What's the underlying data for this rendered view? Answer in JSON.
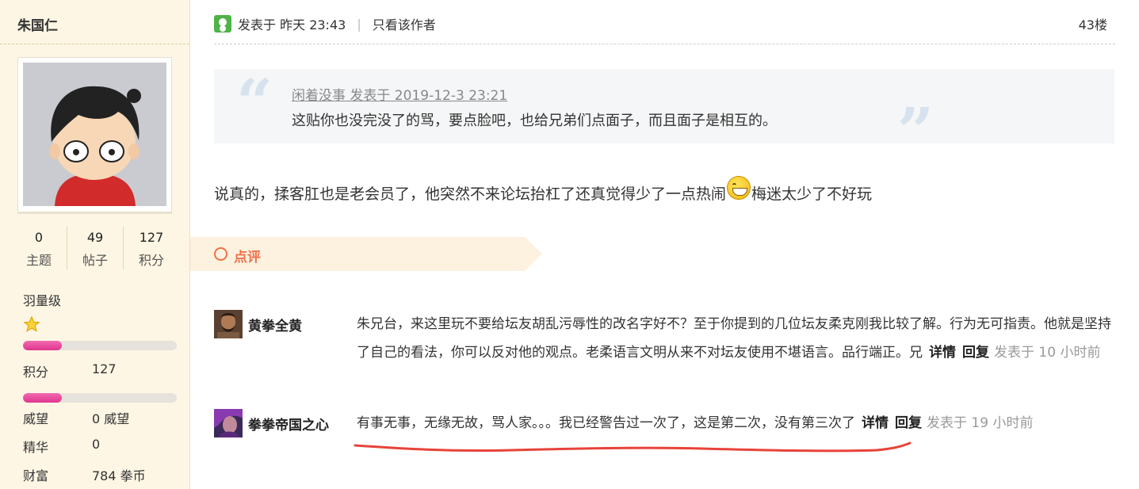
{
  "sidebar": {
    "username": "朱国仁",
    "stats": [
      {
        "value": "0",
        "label": "主题"
      },
      {
        "value": "49",
        "label": "帖子"
      },
      {
        "value": "127",
        "label": "积分"
      }
    ],
    "level": "羽量级",
    "progress_points": 0.25,
    "progress_prestige": 0.25,
    "rows": [
      {
        "label": "积分",
        "value": "127"
      },
      {
        "label": "威望",
        "value": "0 威望"
      },
      {
        "label": "精华",
        "value": "0"
      },
      {
        "label": "财富",
        "value": "784 拳币"
      }
    ]
  },
  "post": {
    "posted_label": "发表于",
    "posted_time": "昨天 23:43",
    "only_author": "只看该作者",
    "floor": "43楼",
    "quote_source": "闲着没事 发表于 2019-12-3 23:21",
    "quote_text": "这贴你也没完没了的骂，要点脸吧，也给兄弟们点面子，而且面子是相互的。",
    "content_before": "说真的，揉客肛也是老会员了，他突然不来论坛抬杠了还真觉得少了一点热闹",
    "content_after": "梅迷太少了不好玩",
    "emoji": "grin-emoji"
  },
  "comments_header": "点评",
  "comments": [
    {
      "user": "黄拳全黄",
      "text": "朱兄台，来这里玩不要给坛友胡乱污辱性的改名字好不？至于你提到的几位坛友柔克刚我比较了解。行为无可指责。他就是坚持了自己的看法，你可以反对他的观点。老柔语言文明从来不对坛友使用不堪语言。品行端正。兄",
      "detail": "详情",
      "reply": "回复",
      "time": "发表于 10 小时前"
    },
    {
      "user": "拳拳帝国之心",
      "text": "有事无事，无缘无故，骂人家。。。我已经警告过一次了，这是第二次，没有第三次了",
      "detail": "详情",
      "reply": "回复",
      "time": "发表于 19 小时前"
    }
  ],
  "colors": {
    "sidebar_bg": "#fdf6e4",
    "accent_orange": "#f0724a",
    "progress_pink": "#e0358f",
    "underline_red": "#e8433a"
  }
}
